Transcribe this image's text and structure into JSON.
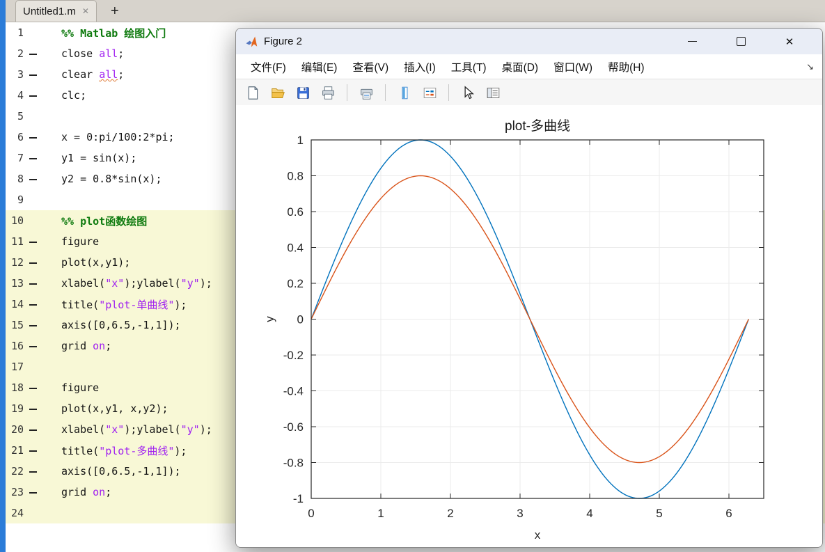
{
  "colors": {
    "desktop_edge": "#2b7cd8",
    "section_highlight": "#f8f8d6",
    "comment_green": "#0e7a0e",
    "string_purple": "#A020F0",
    "curve_blue": "#0072BD",
    "curve_orange": "#D95319"
  },
  "icons": {
    "tab_close": "✕",
    "new_tab": "+",
    "close": "✕",
    "dock_arrow": "↘"
  },
  "editor": {
    "tab": {
      "title": "Untitled1.m"
    },
    "lines": [
      {
        "n": "1",
        "exec": false,
        "hl": false,
        "seg": [
          [
            "%% Matlab 绘图入门",
            "c"
          ]
        ]
      },
      {
        "n": "2",
        "exec": true,
        "hl": false,
        "seg": [
          [
            "close ",
            "k"
          ],
          [
            "all",
            "p"
          ],
          [
            ";",
            "k"
          ]
        ]
      },
      {
        "n": "3",
        "exec": true,
        "hl": false,
        "seg": [
          [
            "clear ",
            "k"
          ],
          [
            "all",
            "pu"
          ],
          [
            ";",
            "k"
          ]
        ]
      },
      {
        "n": "4",
        "exec": true,
        "hl": false,
        "seg": [
          [
            "clc;",
            "k"
          ]
        ]
      },
      {
        "n": "5",
        "exec": false,
        "hl": false,
        "seg": []
      },
      {
        "n": "6",
        "exec": true,
        "hl": false,
        "seg": [
          [
            "x = 0:pi/100:2*pi;",
            "k"
          ]
        ]
      },
      {
        "n": "7",
        "exec": true,
        "hl": false,
        "seg": [
          [
            "y1 = sin(x);",
            "k"
          ]
        ]
      },
      {
        "n": "8",
        "exec": true,
        "hl": false,
        "seg": [
          [
            "y2 = 0.8*sin(x);",
            "k"
          ]
        ]
      },
      {
        "n": "9",
        "exec": false,
        "hl": false,
        "seg": []
      },
      {
        "n": "10",
        "exec": false,
        "hl": true,
        "seg": [
          [
            "%% plot函数绘图",
            "c"
          ]
        ]
      },
      {
        "n": "11",
        "exec": true,
        "hl": true,
        "seg": [
          [
            "figure",
            "k"
          ]
        ]
      },
      {
        "n": "12",
        "exec": true,
        "hl": true,
        "seg": [
          [
            "plot(x,y1);",
            "k"
          ]
        ]
      },
      {
        "n": "13",
        "exec": true,
        "hl": true,
        "seg": [
          [
            "xlabel(",
            "k"
          ],
          [
            "\"x\"",
            "p"
          ],
          [
            ");ylabel(",
            "k"
          ],
          [
            "\"y\"",
            "p"
          ],
          [
            ");",
            "k"
          ]
        ]
      },
      {
        "n": "14",
        "exec": true,
        "hl": true,
        "seg": [
          [
            "title(",
            "k"
          ],
          [
            "\"plot-单曲线\"",
            "p"
          ],
          [
            ");",
            "k"
          ]
        ]
      },
      {
        "n": "15",
        "exec": true,
        "hl": true,
        "seg": [
          [
            "axis([0,6.5,-1,1]);",
            "k"
          ]
        ]
      },
      {
        "n": "16",
        "exec": true,
        "hl": true,
        "seg": [
          [
            "grid ",
            "k"
          ],
          [
            "on",
            "p"
          ],
          [
            ";",
            "k"
          ]
        ]
      },
      {
        "n": "17",
        "exec": false,
        "hl": true,
        "seg": []
      },
      {
        "n": "18",
        "exec": true,
        "hl": true,
        "seg": [
          [
            "figure",
            "k"
          ]
        ]
      },
      {
        "n": "19",
        "exec": true,
        "hl": true,
        "seg": [
          [
            "plot(x,y1, x,y2);",
            "k"
          ]
        ]
      },
      {
        "n": "20",
        "exec": true,
        "hl": true,
        "seg": [
          [
            "xlabel(",
            "k"
          ],
          [
            "\"x\"",
            "p"
          ],
          [
            ");ylabel(",
            "k"
          ],
          [
            "\"y\"",
            "p"
          ],
          [
            ");",
            "k"
          ]
        ]
      },
      {
        "n": "21",
        "exec": true,
        "hl": true,
        "seg": [
          [
            "title(",
            "k"
          ],
          [
            "\"plot-多曲线\"",
            "p"
          ],
          [
            ");",
            "k"
          ]
        ]
      },
      {
        "n": "22",
        "exec": true,
        "hl": true,
        "seg": [
          [
            "axis([0,6.5,-1,1]);",
            "k"
          ]
        ]
      },
      {
        "n": "23",
        "exec": true,
        "hl": true,
        "seg": [
          [
            "grid ",
            "k"
          ],
          [
            "on",
            "p"
          ],
          [
            ";",
            "k"
          ]
        ]
      },
      {
        "n": "24",
        "exec": false,
        "hl": true,
        "seg": []
      }
    ]
  },
  "figure_window": {
    "title": "Figure 2",
    "menu": [
      {
        "id": "file",
        "label": "文件(F)"
      },
      {
        "id": "edit",
        "label": "编辑(E)"
      },
      {
        "id": "view",
        "label": "查看(V)"
      },
      {
        "id": "insert",
        "label": "插入(I)"
      },
      {
        "id": "tools",
        "label": "工具(T)"
      },
      {
        "id": "desktop",
        "label": "桌面(D)"
      },
      {
        "id": "window",
        "label": "窗口(W)"
      },
      {
        "id": "help",
        "label": "帮助(H)"
      }
    ],
    "toolbar": [
      {
        "id": "new-figure"
      },
      {
        "id": "open-file"
      },
      {
        "id": "save-figure"
      },
      {
        "id": "print-figure"
      },
      {
        "sep": true
      },
      {
        "id": "print-preview"
      },
      {
        "sep": true
      },
      {
        "id": "insert-colorbar"
      },
      {
        "id": "insert-legend"
      },
      {
        "sep": true
      },
      {
        "id": "edit-plot"
      },
      {
        "id": "property-inspector"
      }
    ]
  },
  "chart_data": {
    "type": "line",
    "title": "plot-多曲线",
    "xlabel": "x",
    "ylabel": "y",
    "xlim": [
      0,
      6.5
    ],
    "ylim": [
      -1,
      1
    ],
    "xticks": [
      0,
      1,
      2,
      3,
      4,
      5,
      6
    ],
    "yticks": [
      -1,
      -0.8,
      -0.6,
      -0.4,
      -0.2,
      0,
      0.2,
      0.4,
      0.6,
      0.8,
      1
    ],
    "grid": true,
    "legend": "none",
    "x": {
      "start": 0,
      "end": 6.283185,
      "samples": 201,
      "description": "x = 0:pi/100:2*pi"
    },
    "series": [
      {
        "name": "y1 = sin(x)",
        "fn": "sin",
        "amplitude": 1.0,
        "color": "#0072BD"
      },
      {
        "name": "y2 = 0.8*sin(x)",
        "fn": "sin",
        "amplitude": 0.8,
        "color": "#D95319"
      }
    ]
  }
}
